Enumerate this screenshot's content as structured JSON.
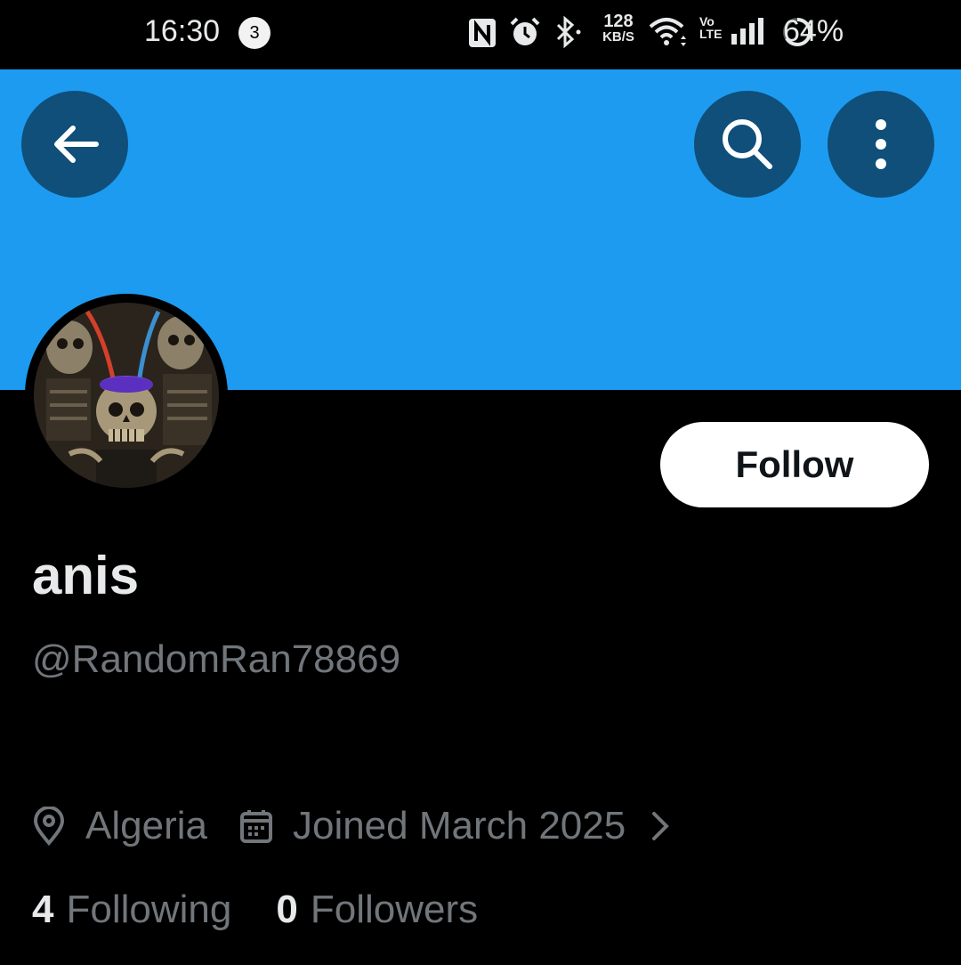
{
  "status_bar": {
    "time": "16:30",
    "notification_count": "3",
    "net_speed_value": "128",
    "net_speed_unit": "KB/S",
    "volte_top": "Vo",
    "volte_bottom": "LTE",
    "battery": "64%"
  },
  "header": {
    "back_icon": "arrow-left-icon",
    "search_icon": "search-icon",
    "more_icon": "more-vertical-icon",
    "banner_color": "#1d9bf0"
  },
  "profile": {
    "display_name": "anis",
    "handle": "@RandomRan78869",
    "follow_label": "Follow",
    "location": "Algeria",
    "joined": "Joined March 2025",
    "following_count": "4",
    "following_label": "Following",
    "followers_count": "0",
    "followers_label": "Followers"
  }
}
